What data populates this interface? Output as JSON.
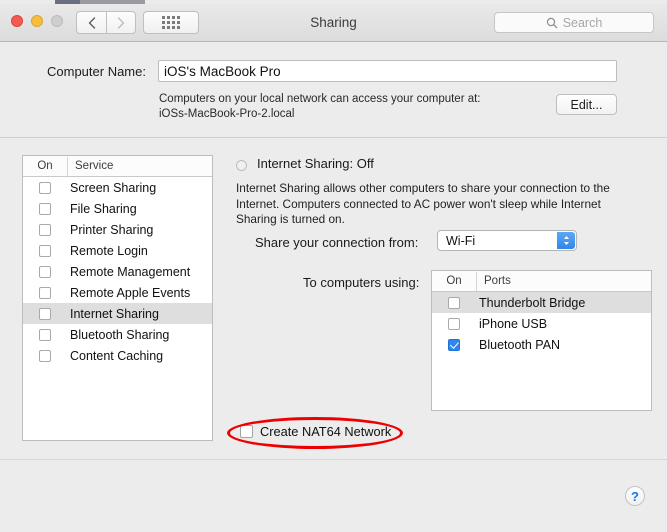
{
  "window": {
    "title": "Sharing",
    "traffic_lights": [
      "close",
      "minimize",
      "zoom"
    ],
    "nav": {
      "back_icon": "chevron-left-icon",
      "forward_icon": "chevron-right-icon"
    },
    "show_all_icon": "grid-dots-icon",
    "search": {
      "placeholder": "Search",
      "icon": "search-icon",
      "value": ""
    }
  },
  "computer_name": {
    "label": "Computer Name:",
    "value": "iOS's MacBook Pro",
    "note_line1": "Computers on your local network can access your computer at:",
    "note_line2": "iOSs-MacBook-Pro-2.local",
    "edit_button": "Edit..."
  },
  "services": {
    "columns": {
      "on": "On",
      "service": "Service"
    },
    "rows": [
      {
        "name": "Screen Sharing",
        "on": false,
        "selected": false
      },
      {
        "name": "File Sharing",
        "on": false,
        "selected": false
      },
      {
        "name": "Printer Sharing",
        "on": false,
        "selected": false
      },
      {
        "name": "Remote Login",
        "on": false,
        "selected": false
      },
      {
        "name": "Remote Management",
        "on": false,
        "selected": false
      },
      {
        "name": "Remote Apple Events",
        "on": false,
        "selected": false
      },
      {
        "name": "Internet Sharing",
        "on": false,
        "selected": true
      },
      {
        "name": "Bluetooth Sharing",
        "on": false,
        "selected": false
      },
      {
        "name": "Content Caching",
        "on": false,
        "selected": false
      }
    ]
  },
  "detail": {
    "status_title": "Internet Sharing: Off",
    "status_indicator": "status-circle-off",
    "description": "Internet Sharing allows other computers to share your connection to the Internet. Computers connected to AC power won't sleep while Internet Sharing is turned on.",
    "share_from_label": "Share your connection from:",
    "share_from_value": "Wi-Fi",
    "to_computers_label": "To computers using:",
    "ports": {
      "columns": {
        "on": "On",
        "ports": "Ports"
      },
      "rows": [
        {
          "name": "Thunderbolt Bridge",
          "on": false,
          "selected": true
        },
        {
          "name": "iPhone USB",
          "on": false,
          "selected": false
        },
        {
          "name": "Bluetooth PAN",
          "on": true,
          "selected": false
        }
      ]
    },
    "nat64": {
      "label": "Create NAT64 Network",
      "checked": false
    }
  },
  "annotation": {
    "shape": "ellipse",
    "color": "#ee0000",
    "target": "Create NAT64 Network"
  },
  "footer": {
    "help_label": "?"
  }
}
